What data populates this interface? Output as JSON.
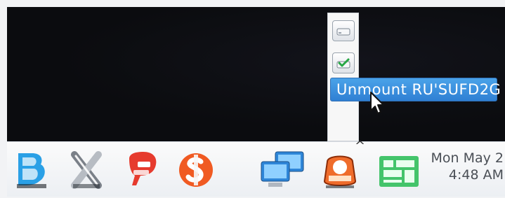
{
  "menu": {
    "unmount_label": "Unmount RU'SUFD2G"
  },
  "tray": {
    "icons": [
      {
        "name": "drive-icon"
      },
      {
        "name": "drive-mounted-icon"
      }
    ]
  },
  "taskbar": {
    "apps": [
      {
        "name": "b-app-icon"
      },
      {
        "name": "x-app-icon"
      },
      {
        "name": "p-app-icon"
      },
      {
        "name": "s-app-icon"
      },
      {
        "name": "network-icon"
      },
      {
        "name": "device-eject-icon"
      },
      {
        "name": "panels-icon"
      }
    ],
    "overflow_caret": "^"
  },
  "clock": {
    "line1": "Mon May 2",
    "line2": "4:48 AM"
  },
  "colors": {
    "menu_bg": "#3b8fdd",
    "desktop_bg": "#0b0c0f",
    "taskbar_bg": "#f0f2f5"
  }
}
